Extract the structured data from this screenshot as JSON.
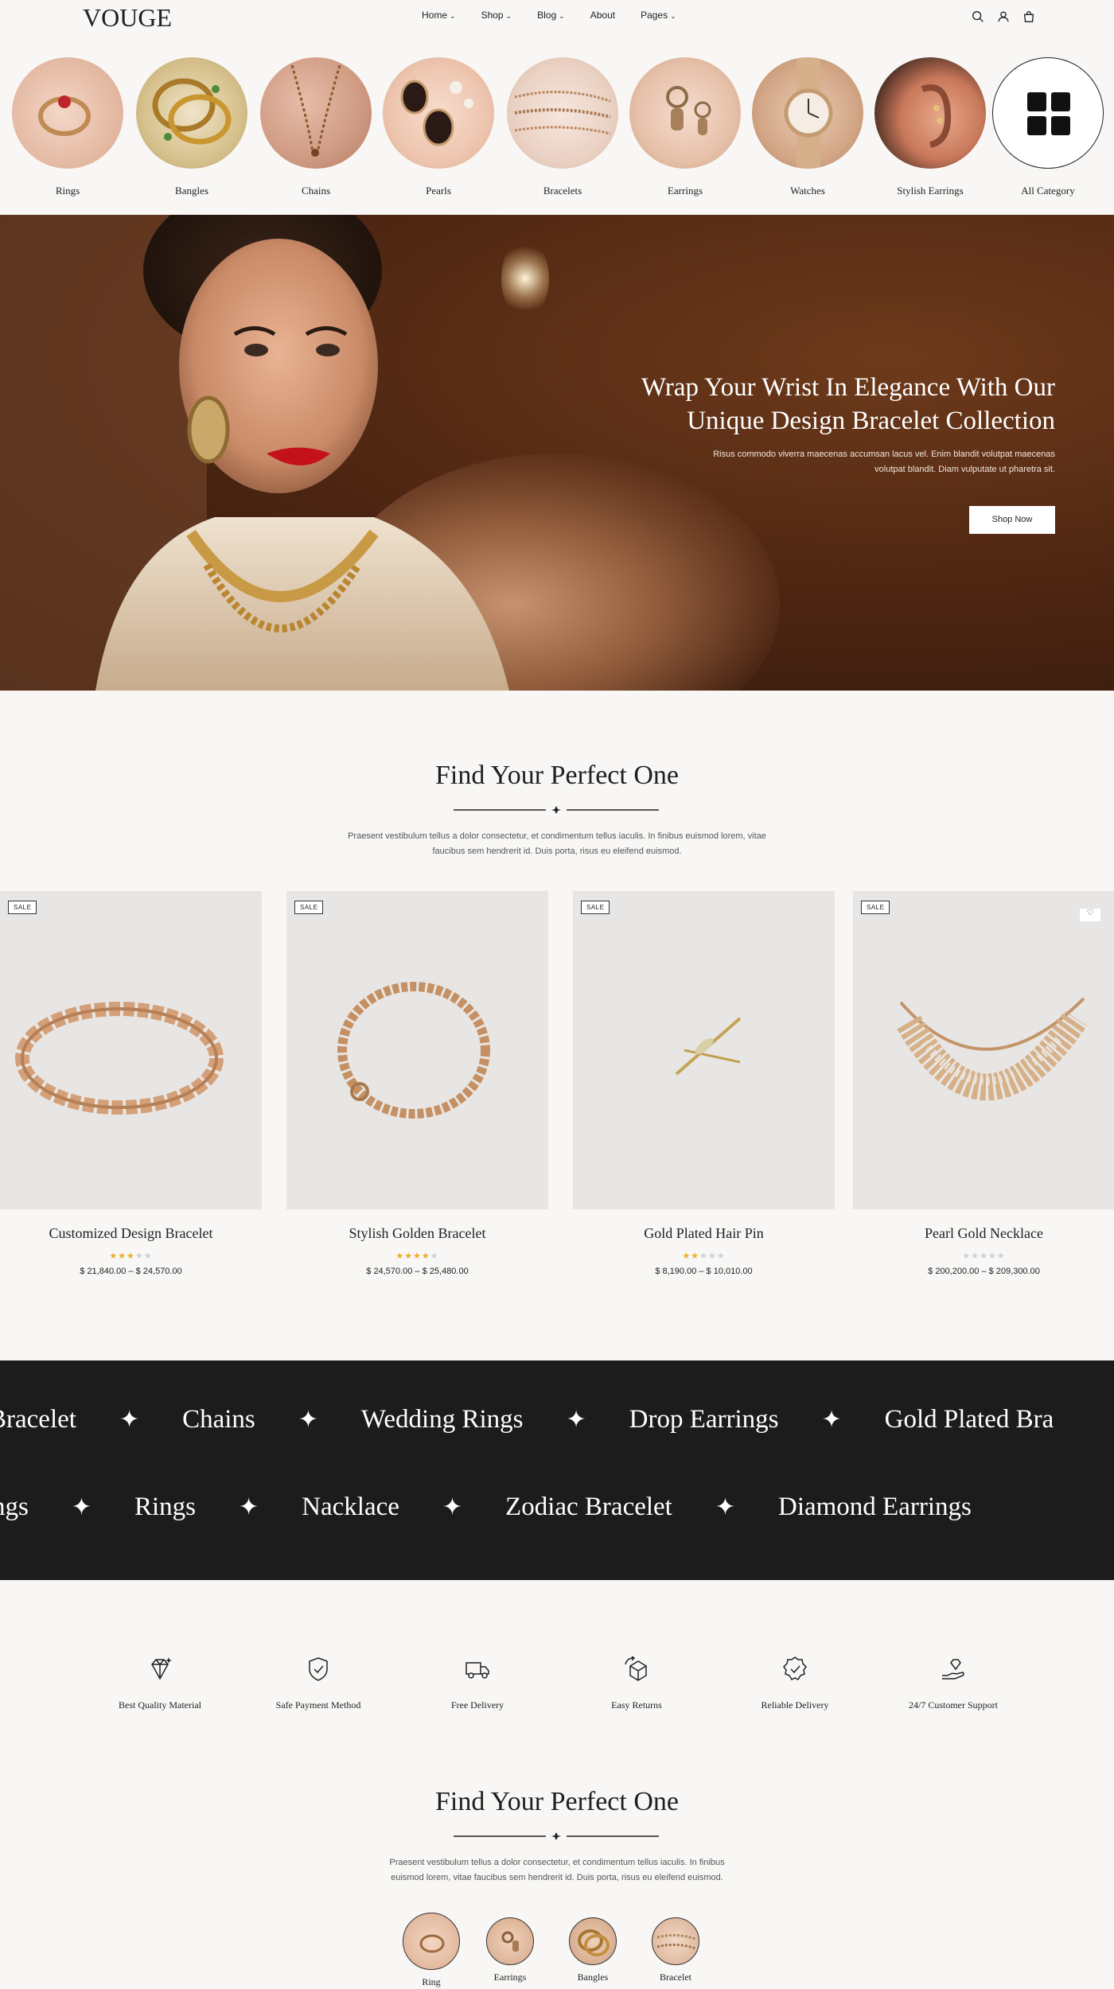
{
  "header": {
    "logo": "Vouge",
    "nav": [
      {
        "label": "Home",
        "has_dropdown": true
      },
      {
        "label": "Shop",
        "has_dropdown": true
      },
      {
        "label": "Blog",
        "has_dropdown": true
      },
      {
        "label": "About",
        "has_dropdown": false
      },
      {
        "label": "Pages",
        "has_dropdown": true
      }
    ],
    "icons": [
      "search-icon",
      "user-icon",
      "cart-icon"
    ]
  },
  "categories": [
    {
      "label": "Rings"
    },
    {
      "label": "Bangles"
    },
    {
      "label": "Chains"
    },
    {
      "label": "Pearls"
    },
    {
      "label": "Bracelets"
    },
    {
      "label": "Earrings"
    },
    {
      "label": "Watches"
    },
    {
      "label": "Stylish Earrings"
    },
    {
      "label": "All Category"
    }
  ],
  "hero": {
    "title_line1": "Wrap Your Wrist In Elegance With Our",
    "title_line2": "Unique Design Bracelet Collection",
    "text_line1": "Risus commodo viverra maecenas accumsan lacus vel. Enim blandit volutpat maecenas",
    "text_line2": "volutpat blandit. Diam vulputate ut pharetra sit.",
    "button": "Shop Now"
  },
  "section1": {
    "title": "Find Your Perfect One",
    "text_line1": "Praesent vestibulum tellus a dolor consectetur, et condimentum tellus iaculis. In finibus euismod lorem, vitae",
    "text_line2": "faucibus sem hendrerit id. Duis porta, risus eu eleifend euismod."
  },
  "products": [
    {
      "badge": "SALE",
      "name": "Customized Design Bracelet",
      "rating": 3,
      "price": "$ 21,840.00 – $ 24,570.00"
    },
    {
      "badge": "SALE",
      "name": "Stylish Golden Bracelet",
      "rating": 4,
      "price": "$ 24,570.00 – $ 25,480.00"
    },
    {
      "badge": "SALE",
      "name": "Gold Plated Hair Pin",
      "rating": 2,
      "price": "$ 8,190.00 – $ 10,010.00"
    },
    {
      "badge": "SALE",
      "name": "Pearl Gold Necklace",
      "rating": 0,
      "price": "$ 200,200.00 – $ 209,300.00"
    }
  ],
  "marquee": {
    "row1": [
      "Bracelet",
      "Chains",
      "Wedding Rings",
      "Drop Earrings",
      "Gold Plated Bra"
    ],
    "row2": [
      "ngs",
      "Rings",
      "Nacklace",
      "Zodiac Bracelet",
      "Diamond Earrings"
    ]
  },
  "features": [
    {
      "icon": "diamond-icon",
      "label": "Best Quality Material"
    },
    {
      "icon": "shield-check-icon",
      "label": "Safe Payment Method"
    },
    {
      "icon": "truck-icon",
      "label": "Free Delivery"
    },
    {
      "icon": "box-return-icon",
      "label": "Easy Returns"
    },
    {
      "icon": "badge-check-icon",
      "label": "Reliable Delivery"
    },
    {
      "icon": "hand-support-icon",
      "label": "24/7 Customer Support"
    }
  ],
  "section2": {
    "title": "Find Your Perfect One",
    "text_line1": "Praesent vestibulum tellus a dolor consectetur, et condimentum tellus iaculis. In finibus",
    "text_line2": "euismod lorem, vitae faucibus sem hendrerit id. Duis porta, risus eu eleifend euismod."
  },
  "bottom_categories": [
    {
      "label": "Ring"
    },
    {
      "label": "Earrings"
    },
    {
      "label": "Bangles"
    },
    {
      "label": "Bracelet"
    }
  ],
  "colors": {
    "accent": "#1c1c1c",
    "star": "#e8b020",
    "hero_bg": "#4a2411",
    "page_bg": "#f8f7f5"
  }
}
